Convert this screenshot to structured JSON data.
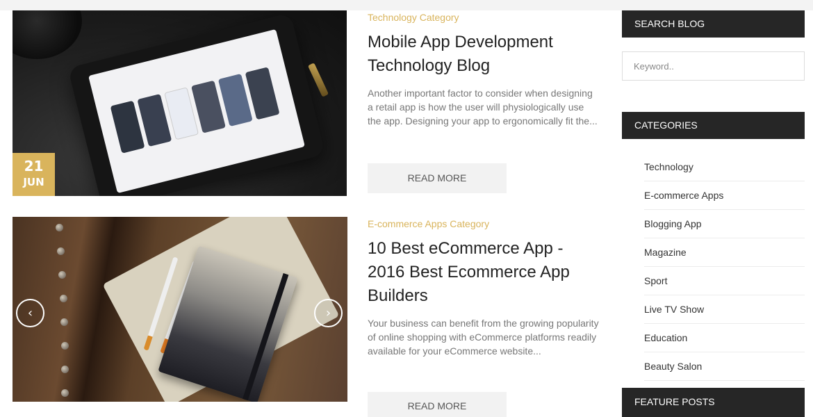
{
  "posts": [
    {
      "date_day": "21",
      "date_month": "JUN",
      "category": "Technology Category",
      "title": "Mobile App Development Technology Blog",
      "excerpt": "Another important factor to consider when designing a retail app is how the user will physiologically use the app. Designing your app to ergonomically fit the...",
      "read_more": "READ MORE"
    },
    {
      "category": "E-commerce Apps Category",
      "title": "10 Best eCommerce App - 2016 Best Ecommerce App Builders",
      "excerpt": "Your business can benefit from the growing popularity of online shopping with eCommerce platforms readily available for your eCommerce website...",
      "read_more": "READ MORE",
      "carousel_prev_icon": "‹",
      "carousel_next_icon": "›"
    }
  ],
  "sidebar": {
    "search_title": "SEARCH BLOG",
    "search_placeholder": "Keyword..",
    "categories_title": "CATEGORIES",
    "categories": [
      "Technology",
      "E-commerce Apps",
      "Blogging App",
      "Magazine",
      "Sport",
      "Live TV Show",
      "Education",
      "Beauty Salon"
    ],
    "featured_title": "FEATURE POSTS"
  },
  "colors": {
    "accent": "#d9b45c",
    "widget_header": "#262626"
  }
}
